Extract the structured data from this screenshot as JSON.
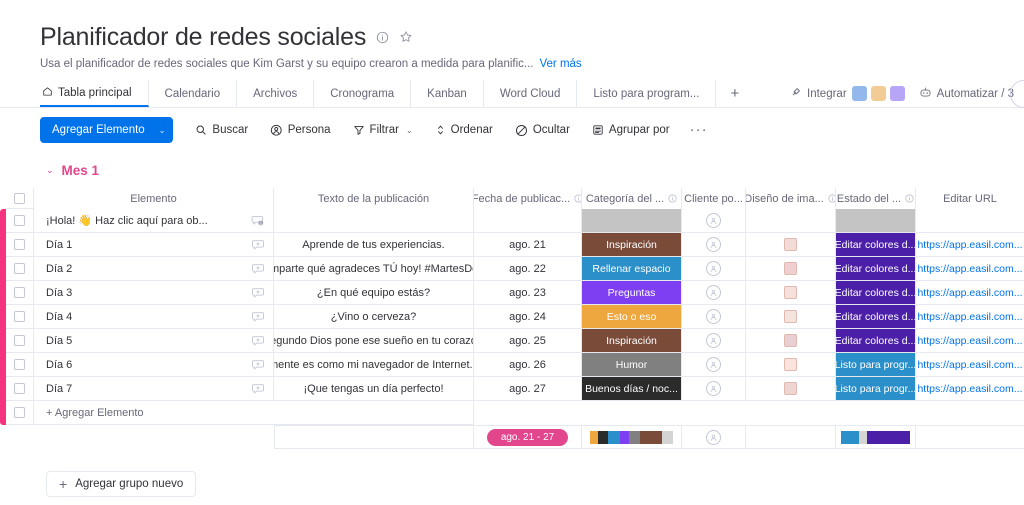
{
  "board": {
    "title": "Planificador de redes sociales",
    "subtitle": "Usa el planificador de redes sociales que Kim Garst y su equipo crearon a medida para planific...",
    "see_more": "Ver más",
    "info_icon": "info-icon",
    "star_icon": "star-icon"
  },
  "tabs": {
    "items": [
      {
        "label": "Tabla principal",
        "icon": "home-icon",
        "active": true
      },
      {
        "label": "Calendario",
        "active": false
      },
      {
        "label": "Archivos",
        "active": false
      },
      {
        "label": "Cronograma",
        "active": false
      },
      {
        "label": "Kanban",
        "active": false
      },
      {
        "label": "Word Cloud",
        "active": false
      },
      {
        "label": "Listo para program...",
        "active": false
      }
    ],
    "add_label": "+",
    "integrate_label": "Integrar",
    "automate_label": "Automatizar / 3",
    "app_colors": [
      "#3b7ddd",
      "#e8a33d",
      "#7b5cf0"
    ]
  },
  "toolbar": {
    "add_item_label": "Agregar Elemento",
    "add_item_caret": "⌄",
    "search_label": "Buscar",
    "person_label": "Persona",
    "filter_label": "Filtrar",
    "sort_label": "Ordenar",
    "hide_label": "Ocultar",
    "group_by_label": "Agrupar por",
    "more_label": "···"
  },
  "group": {
    "caret": "⌄",
    "title": "Mes 1",
    "color": "#e2478d"
  },
  "table": {
    "columns": [
      {
        "label": "Elemento",
        "info": false
      },
      {
        "label": "Texto de la publicación",
        "info": false
      },
      {
        "label": "Fecha de publicac...",
        "info": true
      },
      {
        "label": "Categoría del ...",
        "info": true
      },
      {
        "label": "Cliente po...",
        "info": false
      },
      {
        "label": "Diseño de ima...",
        "info": true
      },
      {
        "label": "Estado del ...",
        "info": true
      },
      {
        "label": "Editar URL",
        "info": false
      }
    ],
    "rows": [
      {
        "item": "¡Hola! 👋 Haz clic aquí para ob...",
        "chat_icon": "chat-badge-icon",
        "post_text": "",
        "date": "",
        "category": {
          "label": "",
          "color": "#c4c4c4"
        },
        "person": "person-avatar-placeholder",
        "design": "",
        "status": {
          "label": "",
          "color": "#c4c4c4"
        },
        "url": ""
      },
      {
        "item": "Día 1",
        "chat_icon": "add-comment-icon",
        "post_text": "Aprende de tus experiencias.",
        "date": "ago. 21",
        "category": {
          "label": "Inspiración",
          "color": "#7b4b3a"
        },
        "person": "person-avatar-placeholder",
        "design": "design-thumbnail",
        "status": {
          "label": "Editar colores d...",
          "color": "#4b1fa8"
        },
        "url": "https://app.easil.com..."
      },
      {
        "item": "Día 2",
        "chat_icon": "add-comment-icon",
        "post_text": "¡Comparte qué agradeces TÚ hoy! #MartesDeA...",
        "date": "ago. 22",
        "category": {
          "label": "Rellenar espacio",
          "color": "#2b8fc9"
        },
        "person": "person-avatar-placeholder",
        "design": "design-thumbnail",
        "status": {
          "label": "Editar colores d...",
          "color": "#4b1fa8"
        },
        "url": "https://app.easil.com..."
      },
      {
        "item": "Día 3",
        "chat_icon": "add-comment-icon",
        "post_text": "¿En qué equipo estás?",
        "date": "ago. 23",
        "category": {
          "label": "Preguntas",
          "color": "#7e3ff2"
        },
        "person": "person-avatar-placeholder",
        "design": "design-thumbnail",
        "status": {
          "label": "Editar colores d...",
          "color": "#4b1fa8"
        },
        "url": "https://app.easil.com..."
      },
      {
        "item": "Día 4",
        "chat_icon": "add-comment-icon",
        "post_text": "¿Vino o cerveza?",
        "date": "ago. 24",
        "category": {
          "label": "Esto o eso",
          "color": "#eda73e"
        },
        "person": "person-avatar-placeholder",
        "design": "design-thumbnail",
        "status": {
          "label": "Editar colores d...",
          "color": "#4b1fa8"
        },
        "url": "https://app.easil.com..."
      },
      {
        "item": "Día 5",
        "chat_icon": "add-comment-icon",
        "post_text": "El segundo Dios pone ese sueño en tu corazón ...",
        "date": "ago. 25",
        "category": {
          "label": "Inspiración",
          "color": "#7b4b3a"
        },
        "person": "person-avatar-placeholder",
        "design": "design-thumbnail",
        "status": {
          "label": "Editar colores d...",
          "color": "#4b1fa8"
        },
        "url": "https://app.easil.com..."
      },
      {
        "item": "Día 6",
        "chat_icon": "add-comment-icon",
        "post_text": "Mi mente es como mi navegador de Internet. H...",
        "date": "ago. 26",
        "category": {
          "label": "Humor",
          "color": "#808080"
        },
        "person": "person-avatar-placeholder",
        "design": "design-thumbnail",
        "status": {
          "label": "Listo para progr...",
          "color": "#2b8fc9"
        },
        "url": "https://app.easil.com..."
      },
      {
        "item": "Día 7",
        "chat_icon": "add-comment-icon",
        "post_text": "¡Que tengas un día perfecto!",
        "date": "ago. 27",
        "category": {
          "label": "Buenos días / noc...",
          "color": "#2b2b2b"
        },
        "person": "person-avatar-placeholder",
        "design": "design-thumbnail",
        "status": {
          "label": "Listo para progr...",
          "color": "#2b8fc9"
        },
        "url": "https://app.easil.com..."
      }
    ],
    "add_item_row_label": "+ Agregar Elemento",
    "summary": {
      "date_range": "ago. 21 - 27",
      "category_distribution": [
        {
          "color": "#eda73e",
          "width": 10
        },
        {
          "color": "#2b2b2b",
          "width": 12
        },
        {
          "color": "#2b8fc9",
          "width": 14
        },
        {
          "color": "#7e3ff2",
          "width": 11
        },
        {
          "color": "#808080",
          "width": 13
        },
        {
          "color": "#7b4b3a",
          "width": 26
        },
        {
          "color": "#d4d4d4",
          "width": 14
        }
      ],
      "status_distribution": [
        {
          "color": "#2b8fc9",
          "width": 26
        },
        {
          "color": "#d4d4d4",
          "width": 12
        },
        {
          "color": "#4b1fa8",
          "width": 62
        }
      ]
    }
  },
  "footer": {
    "add_group_label": "Agregar grupo nuevo",
    "plus_icon": "plus-icon"
  }
}
